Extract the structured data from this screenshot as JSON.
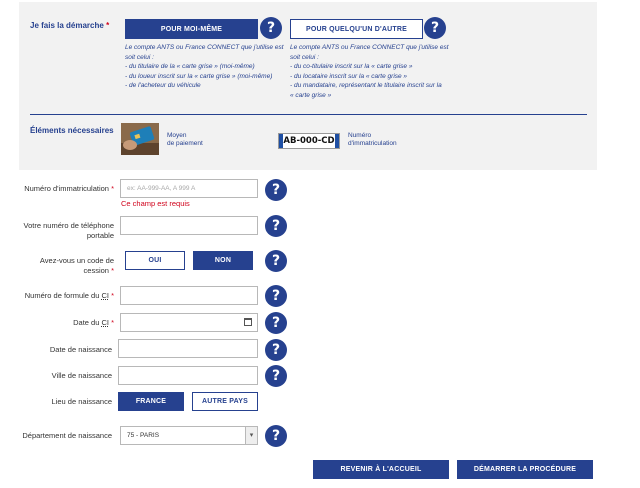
{
  "demarche": {
    "label": "Je fais la démarche",
    "required_mark": "*",
    "pour_moi": {
      "button": "POUR MOI-MÊME",
      "info_lines": [
        "Le compte ANTS ou France CONNECT que j'utilise est",
        "soit celui :",
        "- du titulaire de la « carte grise » (moi-même)",
        "- du loueur inscrit sur la « carte grise » (moi-même)",
        "- de l'acheteur du véhicule"
      ]
    },
    "pour_autre": {
      "button": "POUR QUELQU'UN D'AUTRE",
      "info_lines": [
        "Le compte ANTS ou France CONNECT que j'utilise est",
        "soit celui :",
        "- du co-titulaire inscrit sur la « carte grise »",
        "- du locataire inscrit sur la « carte grise »",
        "- du mandataire, représentant le titulaire inscrit sur la",
        "« carte grise »"
      ]
    }
  },
  "elements": {
    "label": "Éléments nécessaires",
    "payment_line1": "Moyen",
    "payment_line2": "de paiement",
    "plate_text": "AB-000-CD",
    "immat_line1": "Numéro",
    "immat_line2": "d'immatriculation"
  },
  "form": {
    "immat_label": "Numéro d'immatriculation",
    "immat_placeholder": "ex: AA-999-AA, A 999 A",
    "immat_error": "Ce champ est requis",
    "phone_label_1": "Votre numéro de téléphone",
    "phone_label_2": "portable",
    "cession_label_1": "Avez-vous un code de",
    "cession_label_2": "cession",
    "cession_yes": "OUI",
    "cession_no": "NON",
    "formule_label": "Numéro de formule du",
    "ci_abbr": "CI",
    "date_ci_label": "Date du",
    "birth_date_label": "Date de naissance",
    "birth_city_label": "Ville de naissance",
    "birth_place_label": "Lieu de naissance",
    "place_france": "FRANCE",
    "place_other": "AUTRE PAYS",
    "department_label": "Département de naissance",
    "department_value": "75 - PARIS",
    "required_mark": "*",
    "help_symbol": "?"
  },
  "actions": {
    "home": "REVENIR À L'ACCUEIL",
    "start": "DÉMARRER LA PROCÉDURE"
  },
  "colors": {
    "brand_blue": "#26418f",
    "error_red": "#d0021b",
    "panel_grey": "#f2f2f2"
  }
}
